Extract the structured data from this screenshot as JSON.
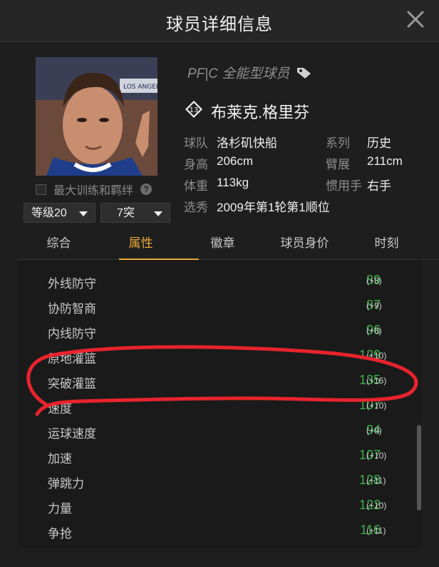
{
  "dialog": {
    "title": "球员详细信息",
    "close_icon": "close-icon"
  },
  "player": {
    "position_label": "PF|C 全能型球员",
    "tag_icon": "tag-icon",
    "number": "13",
    "name": "布莱克.格里芬",
    "photo_jersey_text": "LOS ANGELES"
  },
  "training": {
    "label": "最大训练和羁绊",
    "help_symbol": "?",
    "checked": false
  },
  "selects": {
    "level": "等级20",
    "breakthrough": "7突"
  },
  "info": {
    "team_label": "球队",
    "team_value": "洛杉矶快船",
    "series_label": "系列",
    "series_value": "历史",
    "height_label": "身高",
    "height_value": "206cm",
    "wingspan_label": "臂展",
    "wingspan_value": "211cm",
    "weight_label": "体重",
    "weight_value": "113kg",
    "hand_label": "惯用手",
    "hand_value": "右手",
    "draft_label": "选秀",
    "draft_value": "2009年第1轮第1顺位"
  },
  "tabs": [
    {
      "label": "综合",
      "active": false
    },
    {
      "label": "属性",
      "active": true
    },
    {
      "label": "徽章",
      "active": false
    },
    {
      "label": "球员身价",
      "active": false
    },
    {
      "label": "时刻",
      "active": false
    }
  ],
  "attributes": [
    {
      "label": "外线防守",
      "value": "89",
      "bonus": "(+8)"
    },
    {
      "label": "协防智商",
      "value": "87",
      "bonus": "(+9)"
    },
    {
      "label": "内线防守",
      "value": "96",
      "bonus": "(+8)"
    },
    {
      "label": "原地灌篮",
      "value": "129",
      "bonus": "(+10)"
    },
    {
      "label": "突破灌篮",
      "value": "135",
      "bonus": "(+16)"
    },
    {
      "label": "速度",
      "value": "107",
      "bonus": "(+10)"
    },
    {
      "label": "运球速度",
      "value": "94",
      "bonus": "(+9)"
    },
    {
      "label": "加速",
      "value": "107",
      "bonus": "(+10)"
    },
    {
      "label": "弹跳力",
      "value": "128",
      "bonus": "(+11)"
    },
    {
      "label": "力量",
      "value": "122",
      "bonus": "(+10)"
    },
    {
      "label": "争抢",
      "value": "116",
      "bonus": "(+11)"
    }
  ],
  "colors": {
    "accent": "#e6a93a",
    "value_green": "#3bb04a",
    "annotation_red": "#e8232d"
  }
}
